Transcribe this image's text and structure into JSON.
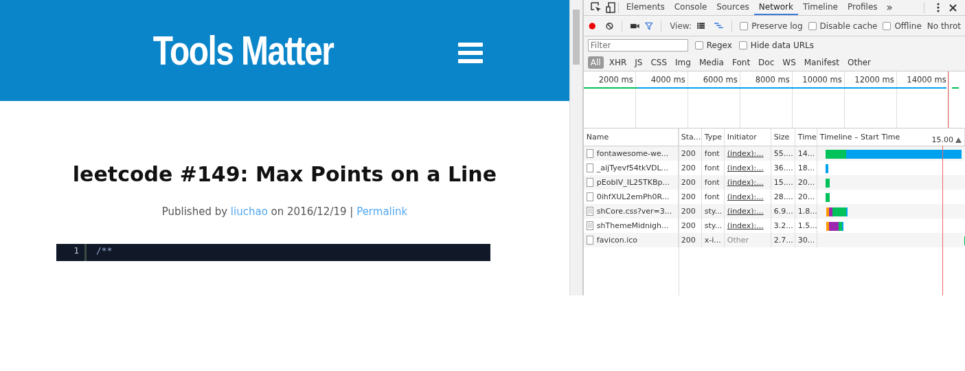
{
  "site": {
    "title": "Tools Matter"
  },
  "post": {
    "title": "leetcode #149: Max Points on a Line",
    "meta": [
      {
        "kind": "text",
        "text": "Published by"
      },
      {
        "kind": "link",
        "text": "liuchao"
      },
      {
        "kind": "text",
        "text": "on 2016/12/19 |"
      },
      {
        "kind": "link",
        "text": "Permalink"
      }
    ]
  },
  "code": {
    "lines": [
      {
        "number": "1",
        "text": "/**"
      }
    ]
  },
  "devtools": {
    "tabs": [
      {
        "label": "Elements",
        "selected": false
      },
      {
        "label": "Console",
        "selected": false
      },
      {
        "label": "Sources",
        "selected": false
      },
      {
        "label": "Network",
        "selected": true
      },
      {
        "label": "Timeline",
        "selected": false
      },
      {
        "label": "Profiles",
        "selected": false
      }
    ],
    "more_tabs": "»",
    "toolbar": {
      "recording": true,
      "view_label": "View:",
      "options": [
        {
          "label": "Preserve log",
          "checked": false
        },
        {
          "label": "Disable cache",
          "checked": false
        },
        {
          "label": "Offline",
          "checked": false
        }
      ],
      "throttling": "No throt"
    },
    "filter": {
      "placeholder": "Filter",
      "options": [
        {
          "label": "Regex",
          "checked": false
        },
        {
          "label": "Hide data URLs",
          "checked": false
        }
      ]
    },
    "types": [
      {
        "label": "All",
        "selected": true
      },
      {
        "label": "XHR",
        "selected": false
      },
      {
        "label": "JS",
        "selected": false
      },
      {
        "label": "CSS",
        "selected": false
      },
      {
        "label": "Img",
        "selected": false
      },
      {
        "label": "Media",
        "selected": false
      },
      {
        "label": "Font",
        "selected": false
      },
      {
        "label": "Doc",
        "selected": false
      },
      {
        "label": "WS",
        "selected": false
      },
      {
        "label": "Manifest",
        "selected": false
      },
      {
        "label": "Other",
        "selected": false
      }
    ],
    "overview_ticks": [
      "2000 ms",
      "4000 ms",
      "6000 ms",
      "8000 ms",
      "10000 ms",
      "12000 ms",
      "14000 ms"
    ],
    "columns": [
      "Name",
      "Sta...",
      "Type",
      "Initiator",
      "Size",
      "Time",
      "Timeline – Start Time"
    ],
    "timeline_marker": "15.00",
    "rows": [
      {
        "kind": "file",
        "name": "fontawesome-we...",
        "status": "200",
        "type": "font",
        "initiator": "(index):...",
        "initiator_link": true,
        "size": "55....",
        "time": "14..."
      },
      {
        "kind": "file",
        "name": "_aijTyevf54tkVDL...",
        "status": "200",
        "type": "font",
        "initiator": "(index):...",
        "initiator_link": true,
        "size": "36....",
        "time": "18..."
      },
      {
        "kind": "file",
        "name": "pEobIV_IL25TKBp...",
        "status": "200",
        "type": "font",
        "initiator": "(index):...",
        "initiator_link": true,
        "size": "15....",
        "time": "20..."
      },
      {
        "kind": "file",
        "name": "0ihfXUL2emPh0R...",
        "status": "200",
        "type": "font",
        "initiator": "(index):...",
        "initiator_link": true,
        "size": "28....",
        "time": "20..."
      },
      {
        "kind": "stylesheet",
        "name": "shCore.css?ver=3...",
        "status": "200",
        "type": "sty...",
        "initiator": "(index):...",
        "initiator_link": true,
        "size": "6.9...",
        "time": "1.8..."
      },
      {
        "kind": "stylesheet",
        "name": "shThemeMidnigh...",
        "status": "200",
        "type": "sty...",
        "initiator": "(index):...",
        "initiator_link": true,
        "size": "3.2...",
        "time": "1.5..."
      },
      {
        "kind": "file",
        "name": "favicon.ico",
        "status": "200",
        "type": "x-i...",
        "initiator": "Other",
        "initiator_link": false,
        "size": "2.7...",
        "time": "30..."
      }
    ]
  }
}
